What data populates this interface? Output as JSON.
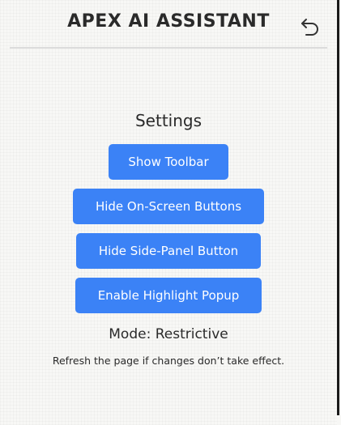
{
  "header": {
    "title": "APEX AI ASSISTANT",
    "back_icon": "undo-arrow-icon"
  },
  "settings": {
    "heading": "Settings",
    "buttons": [
      {
        "label": "Show Toolbar"
      },
      {
        "label": "Hide On-Screen Buttons"
      },
      {
        "label": "Hide Side-Panel Button"
      },
      {
        "label": "Enable Highlight Popup"
      }
    ],
    "mode": "Mode: Restrictive",
    "note": "Refresh the page if changes don’t take effect."
  },
  "colors": {
    "button_bg": "#3b82f6",
    "button_text": "#ffffff",
    "background": "#f8f8f6"
  }
}
